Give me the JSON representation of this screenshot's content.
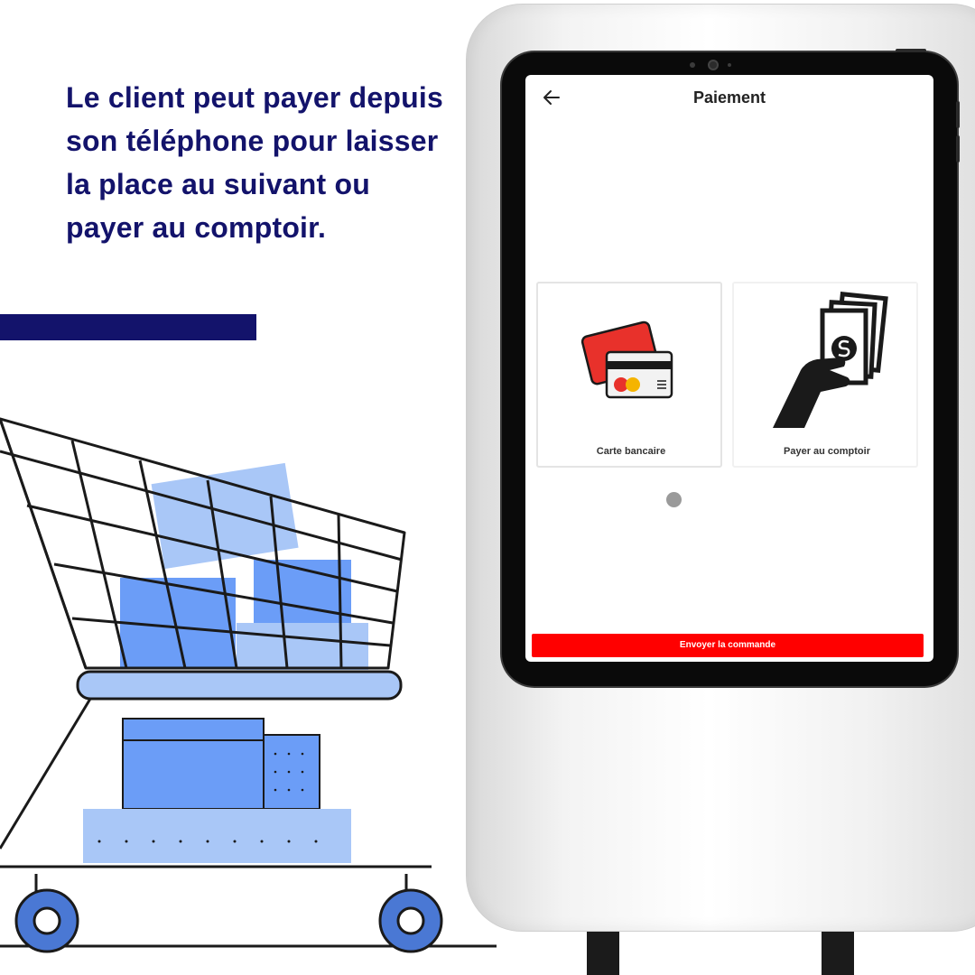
{
  "headline": "Le client peut payer depuis son téléphone pour laisser la place au suivant ou payer au comptoir.",
  "colors": {
    "navy": "#13136b",
    "red": "#ff0000",
    "cart_blue": "#6b9df7",
    "cart_blue_light": "#a9c7f7"
  },
  "screen": {
    "title": "Paiement",
    "back_icon": "arrow-left-icon",
    "options": [
      {
        "label": "Carte bancaire",
        "icon": "credit-card-icon"
      },
      {
        "label": "Payer au comptoir",
        "icon": "cash-hand-icon"
      }
    ],
    "submit_label": "Envoyer la commande"
  }
}
